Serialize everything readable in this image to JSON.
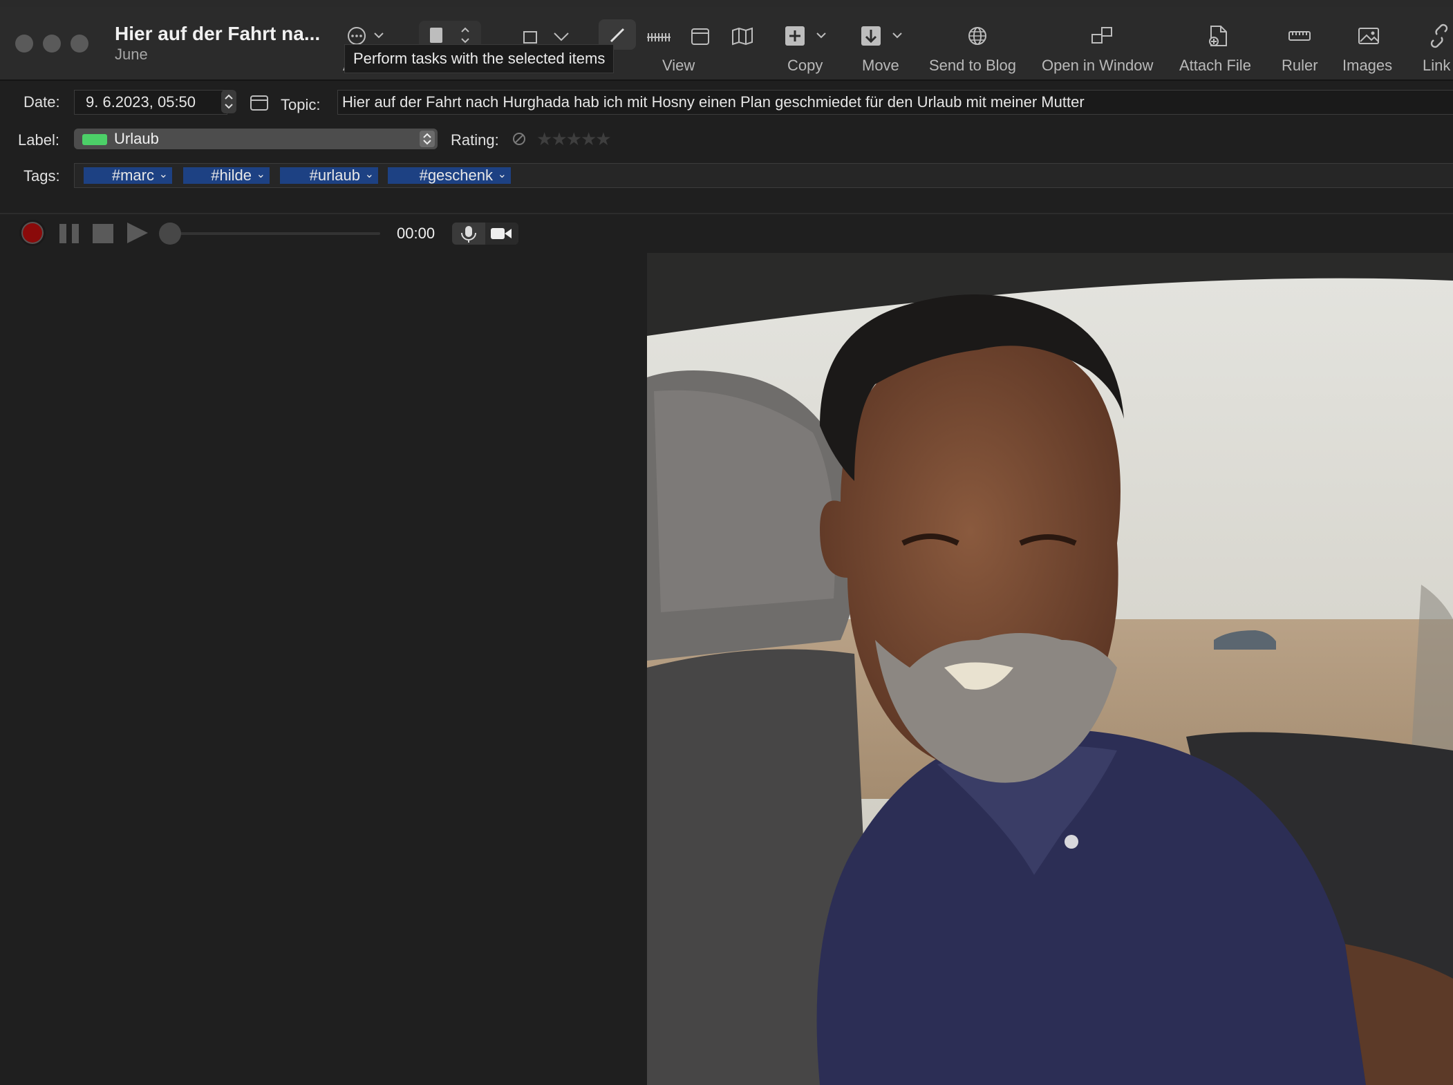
{
  "window": {
    "title": "Hier auf der Fahrt na...",
    "subtitle": "June"
  },
  "toolbar": {
    "tooltip": "Perform tasks with the selected items",
    "items": [
      {
        "label": "View"
      },
      {
        "label": "Copy"
      },
      {
        "label": "Move"
      },
      {
        "label": "Send to Blog"
      },
      {
        "label": "Open in Window"
      },
      {
        "label": "Attach File"
      },
      {
        "label": "Ruler"
      },
      {
        "label": "Images"
      },
      {
        "label": "Link"
      }
    ],
    "partial_label": "A"
  },
  "entry": {
    "date_label": "Date:",
    "date_value": "9. 6.2023, 05:50",
    "topic_label": "Topic:",
    "topic_value": "Hier auf der Fahrt nach Hurghada hab ich mit Hosny einen Plan geschmiedet für den Urlaub mit meiner Mutter",
    "label_label": "Label:",
    "label_value": "Urlaub",
    "label_color": "#4cd068",
    "rating_label": "Rating:",
    "rating_value": 0,
    "rating_max": 5,
    "tags_label": "Tags:",
    "tags": [
      "#marc",
      "#hilde",
      "#urlaub",
      "#geschenk"
    ],
    "tag_color": "#1d4183"
  },
  "recorder": {
    "time": "00:00",
    "record_color": "#8a0a0a"
  },
  "photo": {
    "icon": "photo-man-in-car"
  }
}
